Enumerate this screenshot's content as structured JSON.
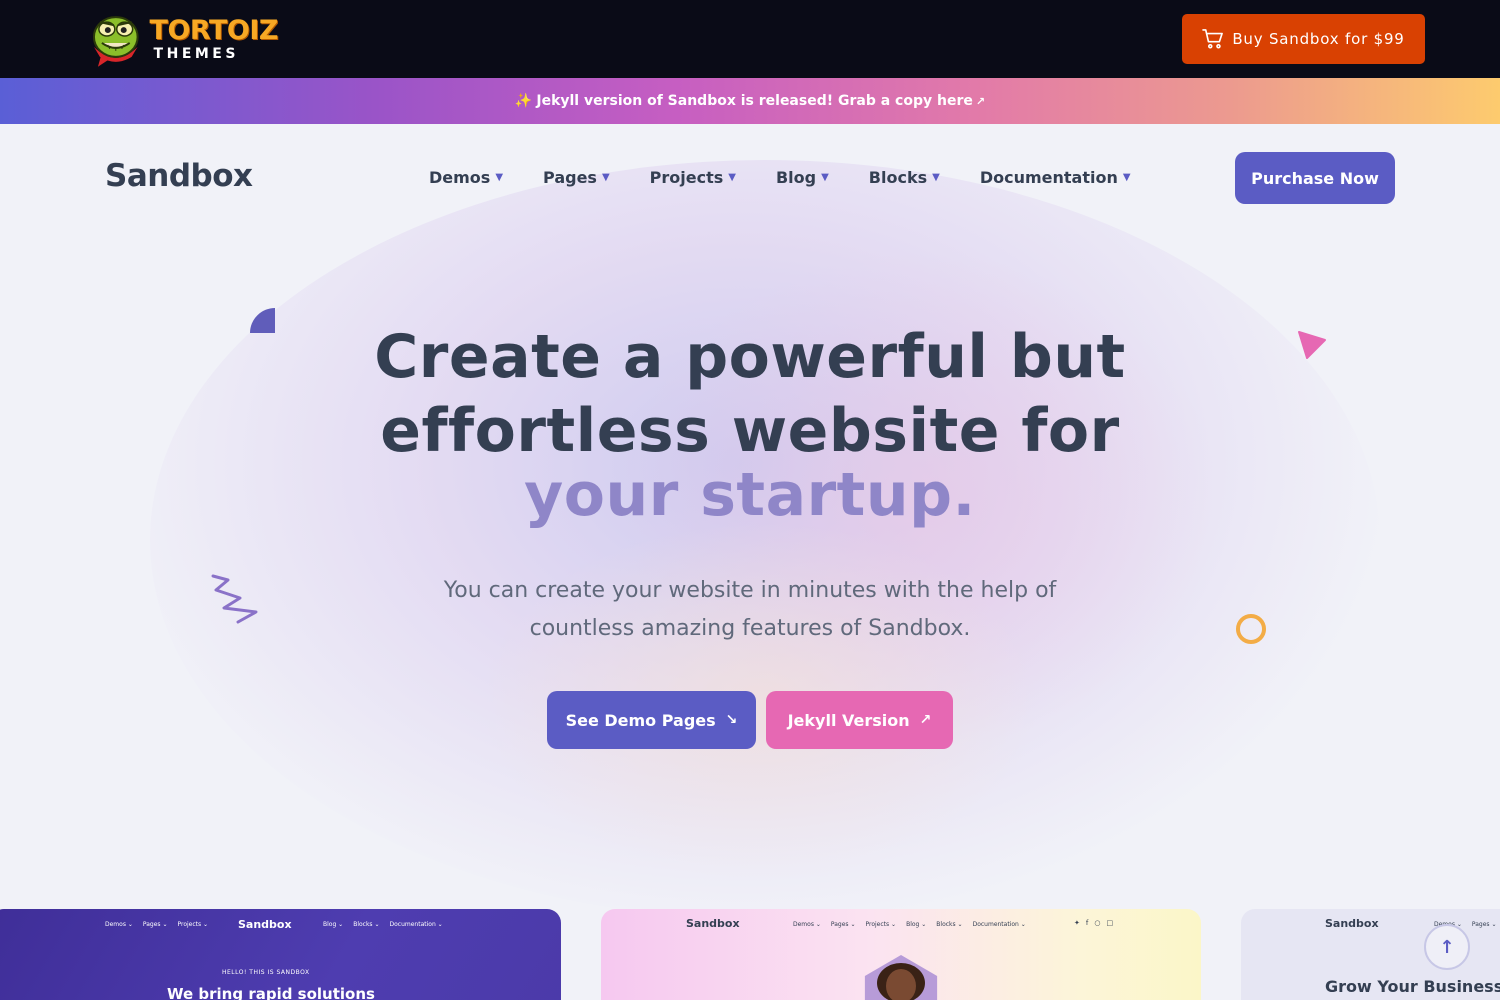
{
  "topbar": {
    "logo_brand": "TORTOIZ",
    "logo_sub": "THEMES",
    "buy_button": "Buy Sandbox for $99"
  },
  "announcement": {
    "text": "Jekyll version of Sandbox is released! Grab a copy here",
    "spark_glyph": "✨",
    "arrow_glyph": "↗"
  },
  "nav": {
    "brand": "Sandbox",
    "items": [
      {
        "label": "Demos"
      },
      {
        "label": "Pages"
      },
      {
        "label": "Projects"
      },
      {
        "label": "Blog"
      },
      {
        "label": "Blocks"
      },
      {
        "label": "Documentation"
      }
    ],
    "chevron_glyph": "⌄",
    "purchase_button": "Purchase Now"
  },
  "hero": {
    "title_line1": "Create a powerful but",
    "title_line2": "effortless website for",
    "title_line3": "your startup.",
    "subtitle": "You can create your website in minutes with the help of countless amazing features of Sandbox.",
    "demo_button": "See Demo Pages",
    "demo_button_icon": "↘",
    "jekyll_button": "Jekyll Version",
    "jekyll_button_icon": "↗"
  },
  "previews": {
    "card1": {
      "brand": "Sandbox",
      "nav_left": [
        "Demos ⌄",
        "Pages ⌄",
        "Projects ⌄"
      ],
      "nav_right": [
        "Blog ⌄",
        "Blocks ⌄",
        "Documentation ⌄"
      ],
      "tag": "HELLO! THIS IS SANDBOX",
      "headline": "We bring rapid solutions"
    },
    "card2": {
      "brand": "Sandbox",
      "nav": [
        "Demos ⌄",
        "Pages ⌄",
        "Projects ⌄",
        "Blog ⌄",
        "Blocks ⌄",
        "Documentation ⌄"
      ]
    },
    "card3": {
      "brand": "Sandbox",
      "nav": [
        "Demos ⌄",
        "Pages ⌄"
      ],
      "headline": "Grow Your Business wit"
    }
  },
  "scroll_top_glyph": "↑",
  "colors": {
    "primary": "#5b5cc4",
    "pink": "#e668b3",
    "buy_orange": "#d94102",
    "topbar_bg": "#0a0b17"
  }
}
